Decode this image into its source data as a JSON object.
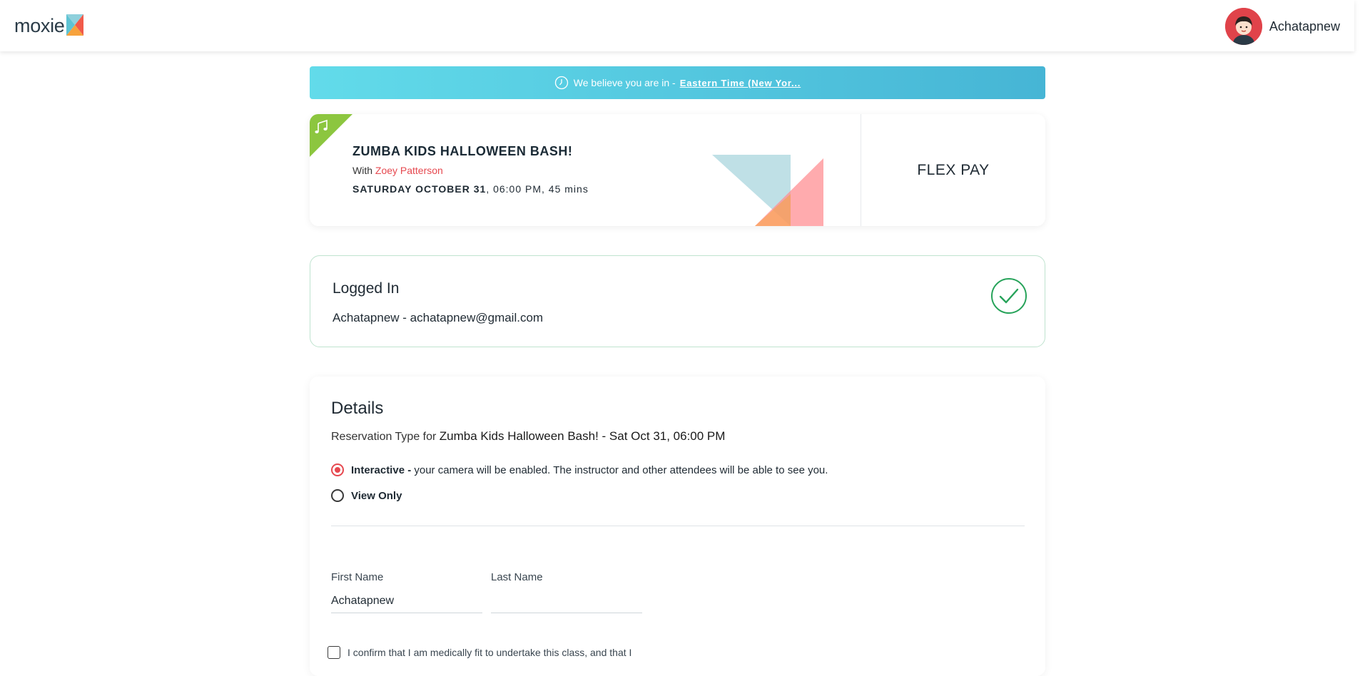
{
  "header": {
    "logo_text": "moxie",
    "user_name": "Achatapnew"
  },
  "timezone_banner": {
    "prefix": "We believe you are in -",
    "timezone_link": "Eastern Time (New Yor..."
  },
  "class_card": {
    "title": "ZUMBA KIDS HALLOWEEN BASH!",
    "with_prefix": "With",
    "instructor": "Zoey Patterson",
    "date": "SATURDAY OCTOBER 31",
    "time_duration": ", 06:00 PM, 45 mins",
    "pricing_label": "FLEX PAY",
    "ribbon_color": "#8cc63f"
  },
  "login": {
    "title": "Logged In",
    "info": "Achatapnew - achatapnew@gmail.com",
    "check_color": "#27a35a"
  },
  "details": {
    "title": "Details",
    "reservation_prefix": "Reservation Type for",
    "reservation_class": "Zumba Kids Halloween Bash! - Sat Oct 31, 06:00 PM",
    "options": [
      {
        "label": "Interactive -",
        "description": "your camera will be enabled. The instructor and other attendees will be able to see you.",
        "selected": true
      },
      {
        "label": "View Only",
        "description": "",
        "selected": false
      }
    ],
    "first_name_label": "First Name",
    "first_name_value": "Achatapnew",
    "last_name_label": "Last Name",
    "last_name_value": "",
    "confirm_text": "I confirm that I am medically fit to undertake this class, and that I"
  },
  "colors": {
    "accent": "#e6484f",
    "banner_start": "#62dbea",
    "banner_end": "#46b5d5"
  }
}
